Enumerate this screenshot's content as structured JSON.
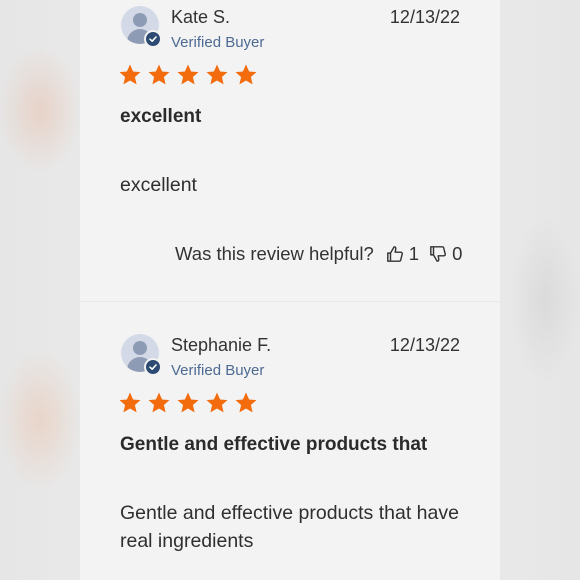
{
  "reviews": [
    {
      "name": "Kate S.",
      "verified_label": "Verified Buyer",
      "date": "12/13/22",
      "rating": 5,
      "headline": "excellent",
      "body": "excellent",
      "helpful_question": "Was this review helpful?",
      "thumbs_up_count": "1",
      "thumbs_down_count": "0"
    },
    {
      "name": "Stephanie F.",
      "verified_label": "Verified Buyer",
      "date": "12/13/22",
      "rating": 5,
      "headline": "Gentle and effective products that",
      "body": "Gentle and effective products that have real ingredients"
    }
  ],
  "icons": {
    "avatar": "person-avatar-icon",
    "verified": "check-badge-icon",
    "star": "star-icon",
    "thumbs_up": "thumbs-up-icon",
    "thumbs_down": "thumbs-down-icon"
  },
  "colors": {
    "star": "#f26b0c",
    "verified_text": "#4d6a93",
    "badge": "#2d4a72",
    "card_bg": "#f3f3f3"
  }
}
